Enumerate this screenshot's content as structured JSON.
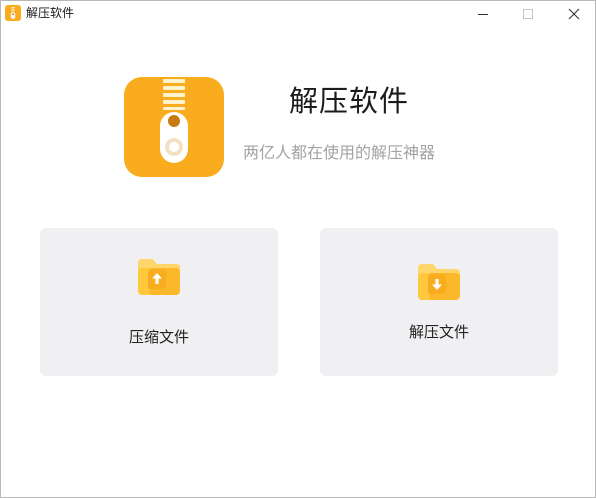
{
  "window": {
    "title": "解压软件",
    "controls": {
      "minimize": "minimize-icon",
      "maximize": "maximize-icon",
      "close": "close-icon"
    }
  },
  "hero": {
    "title": "解压软件",
    "subtitle": "两亿人都在使用的解压神器",
    "logo_icon": "zipper-icon"
  },
  "actions": [
    {
      "label": "压缩文件",
      "icon": "folder-upload-icon"
    },
    {
      "label": "解压文件",
      "icon": "folder-download-icon"
    }
  ],
  "colors": {
    "brand_orange": "#f9ac1e",
    "folder_light": "#ffd66b",
    "card_bg": "#f0f0f3",
    "subtitle_gray": "#a3a3a3"
  }
}
